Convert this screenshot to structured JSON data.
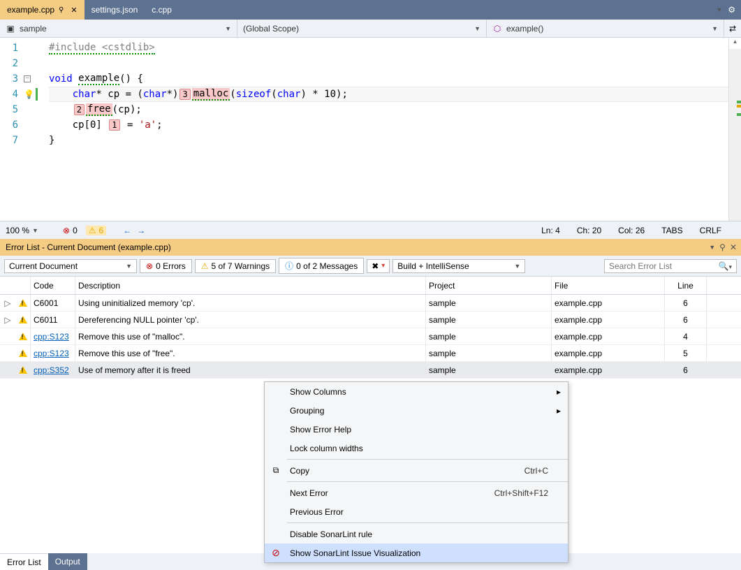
{
  "tabs": [
    {
      "label": "example.cpp",
      "active": true,
      "pinned": true
    },
    {
      "label": "settings.json",
      "active": false
    },
    {
      "label": "c.cpp",
      "active": false
    }
  ],
  "nav": {
    "class": "sample",
    "scope": "(Global Scope)",
    "member": "example()"
  },
  "code": {
    "lines": [
      1,
      2,
      3,
      4,
      5,
      6,
      7
    ],
    "include": "#include",
    "header": "<cstdlib>",
    "void": "void",
    "example": "example",
    "char": "char",
    "cp": "cp",
    "malloc": "malloc",
    "sizeof": "sizeof",
    "free": "free",
    "char_a": "'a'",
    "box1": "1",
    "box2": "2",
    "box3": "3",
    "line1": "#include <cstdlib>",
    "line4_prefix": "    char* cp = (char*)",
    "line4_mid": " malloc(sizeof(char) * 10);",
    "line5_suffix": "(cp);",
    "line6_prefix": "    cp[0] ",
    "line6_suffix": " = 'a';"
  },
  "status": {
    "zoom": "100 %",
    "errors": "0",
    "warnings": "6",
    "ln": "Ln: 4",
    "ch": "Ch: 20",
    "col": "Col: 26",
    "tabs": "TABS",
    "crlf": "CRLF"
  },
  "errorlist": {
    "title": "Error List - Current Document (example.cpp)",
    "scope": "Current Document",
    "errors": "0 Errors",
    "warnings": "5 of 7 Warnings",
    "messages": "0 of 2 Messages",
    "build": "Build + IntelliSense",
    "search_placeholder": "Search Error List",
    "columns": {
      "code": "Code",
      "desc": "Description",
      "project": "Project",
      "file": "File",
      "line": "Line"
    },
    "rows": [
      {
        "expand": true,
        "code": "C6001",
        "desc": "Using uninitialized memory 'cp'.",
        "project": "sample",
        "file": "example.cpp",
        "line": "6",
        "link": false
      },
      {
        "expand": true,
        "code": "C6011",
        "desc": "Dereferencing NULL pointer 'cp'.",
        "project": "sample",
        "file": "example.cpp",
        "line": "6",
        "link": false
      },
      {
        "expand": false,
        "code": "cpp:S123",
        "desc": "Remove this use of \"malloc\".",
        "project": "sample",
        "file": "example.cpp",
        "line": "4",
        "link": true
      },
      {
        "expand": false,
        "code": "cpp:S123",
        "desc": "Remove this use of \"free\".",
        "project": "sample",
        "file": "example.cpp",
        "line": "5",
        "link": true
      },
      {
        "expand": false,
        "code": "cpp:S352",
        "desc": "Use of memory after it is freed",
        "project": "sample",
        "file": "example.cpp",
        "line": "6",
        "link": true,
        "selected": true
      }
    ]
  },
  "bottom_tabs": {
    "error": "Error List",
    "output": "Output"
  },
  "context_menu": {
    "show_columns": "Show Columns",
    "grouping": "Grouping",
    "show_help": "Show Error Help",
    "lock": "Lock column widths",
    "copy": "Copy",
    "copy_sc": "Ctrl+C",
    "next": "Next Error",
    "next_sc": "Ctrl+Shift+F12",
    "prev": "Previous Error",
    "disable": "Disable SonarLint rule",
    "show_sonar": "Show SonarLint Issue Visualization"
  }
}
